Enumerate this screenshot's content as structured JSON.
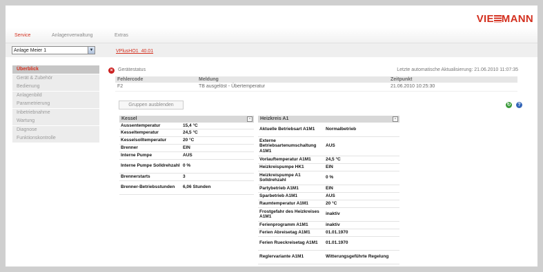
{
  "brand": {
    "logo": "VIESMANN",
    "logo_prefix": "VIE",
    "logo_suffix": "MANN",
    "accent": "#d32f1e"
  },
  "nav": {
    "items": [
      "Service",
      "Anlagenverwaltung",
      "Extras"
    ],
    "active": "Service"
  },
  "plant_select": {
    "value": "Anlage Meier 1"
  },
  "device_link": "VPlusHO1_40.01",
  "sidebar": {
    "items": [
      "Überblick",
      "Gerät & Zubehör",
      "Bedienung",
      "Anlagenbild",
      "Parametrierung",
      "Inbetriebnahme",
      "Wartung",
      "Diagnose",
      "Funktionskontrolle"
    ],
    "active": "Überblick"
  },
  "device_status": {
    "title": "Gerätestatus",
    "last_update": "Letzte automatische Aktualisierung: 21.06.2010 11:07:35",
    "columns": [
      "Fehlercode",
      "Meldung",
      "Zeitpunkt"
    ],
    "rows": [
      {
        "code": "F2",
        "message": "TB ausgelöst - Übertemperatur",
        "time": "21.06.2010 10:25:30"
      }
    ]
  },
  "group_button": "Gruppen ausblenden",
  "icons": {
    "refresh": "refresh-icon",
    "help": "help-icon"
  },
  "kessel": {
    "title": "Kessel",
    "rows": [
      {
        "label": "Aussentemperatur",
        "value": "15,4 °C"
      },
      {
        "label": "Kesseltemperatur",
        "value": "24,5 °C"
      },
      {
        "label": "Kesselsolltemperatur",
        "value": "20 °C"
      },
      {
        "label": "Brenner",
        "value": "EIN"
      },
      {
        "label": "Interne Pumpe",
        "value": "AUS"
      },
      {
        "label": "Interne Pumpe Solldrehzahl",
        "value": "0 %"
      },
      {
        "label": "Brennerstarts",
        "value": "3"
      },
      {
        "label": "Brenner-Betriebsstunden",
        "value": "6,06 Stunden"
      }
    ]
  },
  "heizkreis": {
    "title": "Heizkreis A1",
    "rows": [
      {
        "label": "Aktuelle Betriebsart A1M1",
        "value": "Normalbetrieb"
      },
      {
        "label": "Externe Betriebsartenumschaltung A1M1",
        "value": "AUS"
      },
      {
        "label": "Vorlauftemperatur A1M1",
        "value": "24,5 °C"
      },
      {
        "label": "Heizkreispumpe HK1",
        "value": "EIN"
      },
      {
        "label": "Heizkreispumpe A1 Solldrehzahl",
        "value": "0 %"
      },
      {
        "label": "Partybetrieb A1M1",
        "value": "EIN"
      },
      {
        "label": "Sparbetrieb A1M1",
        "value": "AUS"
      },
      {
        "label": "Raumtemperatur A1M1",
        "value": "20 °C"
      },
      {
        "label": "Frostgefahr des Heizkreises A1M1",
        "value": "inaktiv"
      },
      {
        "label": "Ferienprogramm A1M1",
        "value": "inaktiv"
      },
      {
        "label": "Ferien Abreisetag A1M1",
        "value": "01.01.1970"
      },
      {
        "label": "Ferien Rueckreisetag A1M1",
        "value": "01.01.1970"
      },
      {
        "label": "Reglervariante A1M1",
        "value": "Witterungsgeführte Regelung"
      }
    ]
  }
}
